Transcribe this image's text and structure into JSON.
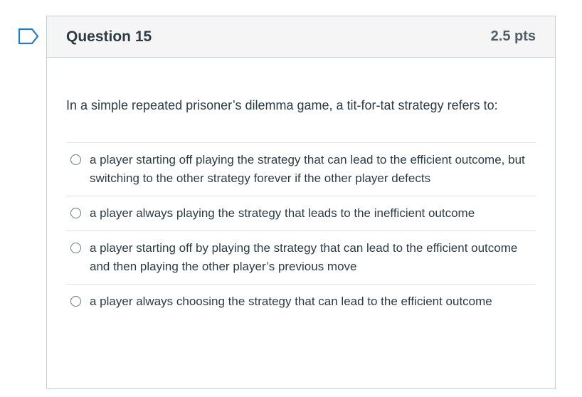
{
  "question": {
    "title": "Question 15",
    "points": "2.5 pts",
    "text": "In a simple repeated prisoner’s dilemma game, a tit-for-tat strategy refers to:"
  },
  "answers": [
    {
      "label": "a player starting off playing the strategy that can lead to the efficient outcome, but switching to the other strategy forever if the other player defects",
      "selected": false
    },
    {
      "label": "a player always playing the strategy that leads to the inefficient outcome",
      "selected": false
    },
    {
      "label": "a player starting off by playing the strategy that can lead to the efficient outcome and then playing the other player’s previous move",
      "selected": false
    },
    {
      "label": "a player always choosing the strategy that can lead to the efficient outcome",
      "selected": false
    }
  ],
  "icons": {
    "flag": "flag-question-icon"
  },
  "colors": {
    "flag": "#2b7abc",
    "border": "#c7cdd1",
    "header_bg": "#f5f5f5",
    "text": "#2d3b45"
  }
}
